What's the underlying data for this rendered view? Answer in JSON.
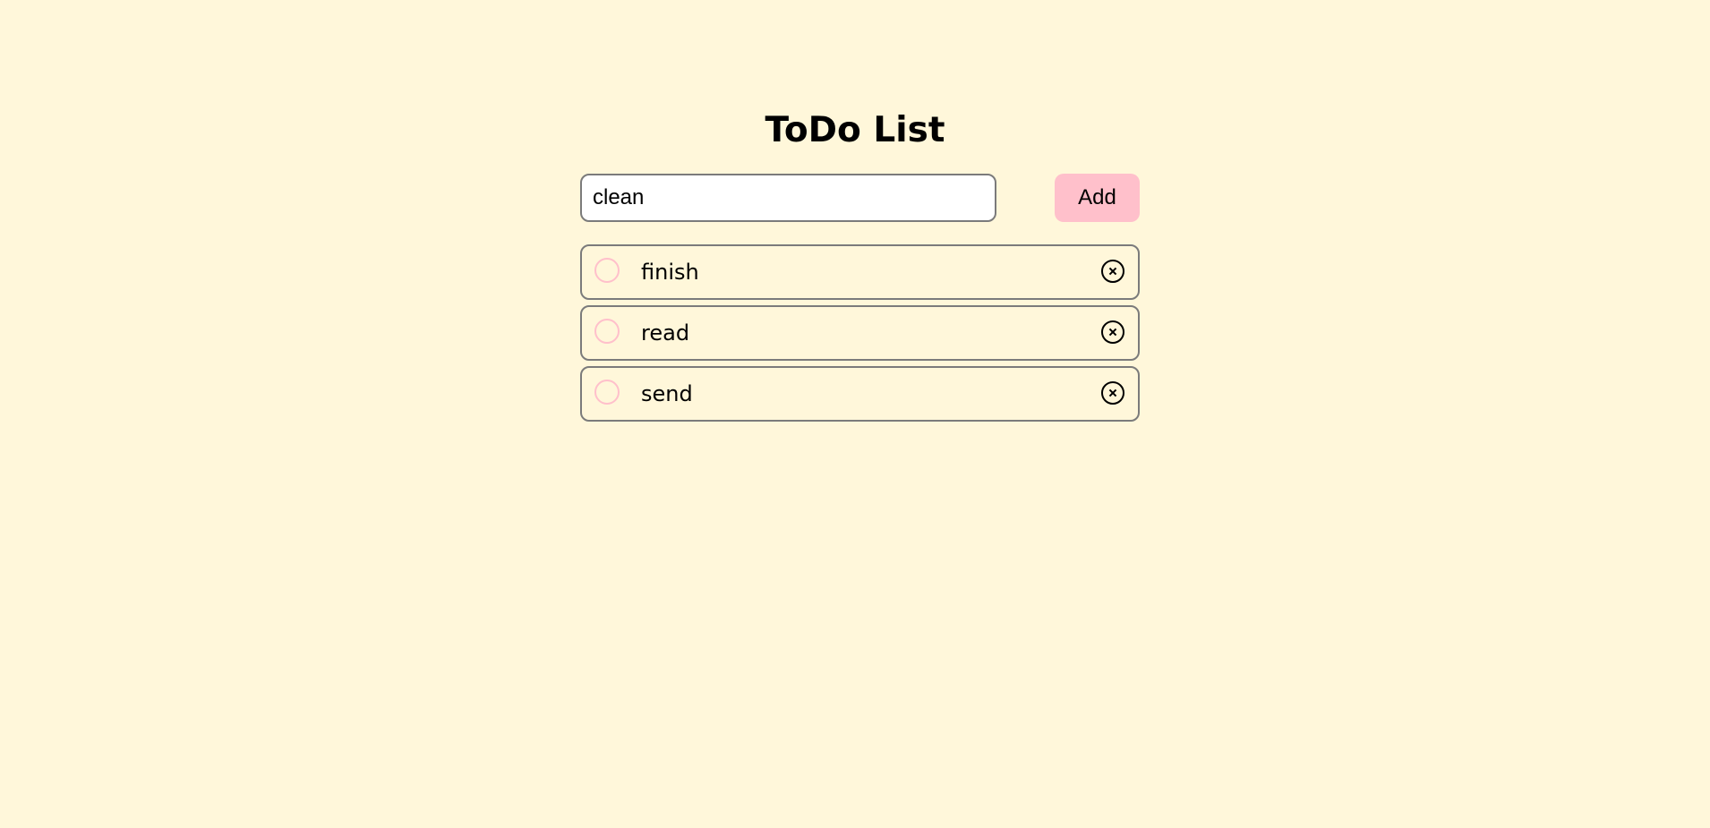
{
  "header": {
    "title": "ToDo List"
  },
  "input": {
    "value": "clean",
    "add_label": "Add"
  },
  "todos": [
    {
      "text": "finish",
      "completed": false
    },
    {
      "text": "read",
      "completed": false
    },
    {
      "text": "send",
      "completed": false
    }
  ],
  "colors": {
    "background": "#fff7da",
    "accent": "#ffc0cb",
    "border": "#7b7b7b"
  },
  "icons": {
    "check": "empty-circle-icon",
    "delete": "close-circle-icon"
  }
}
